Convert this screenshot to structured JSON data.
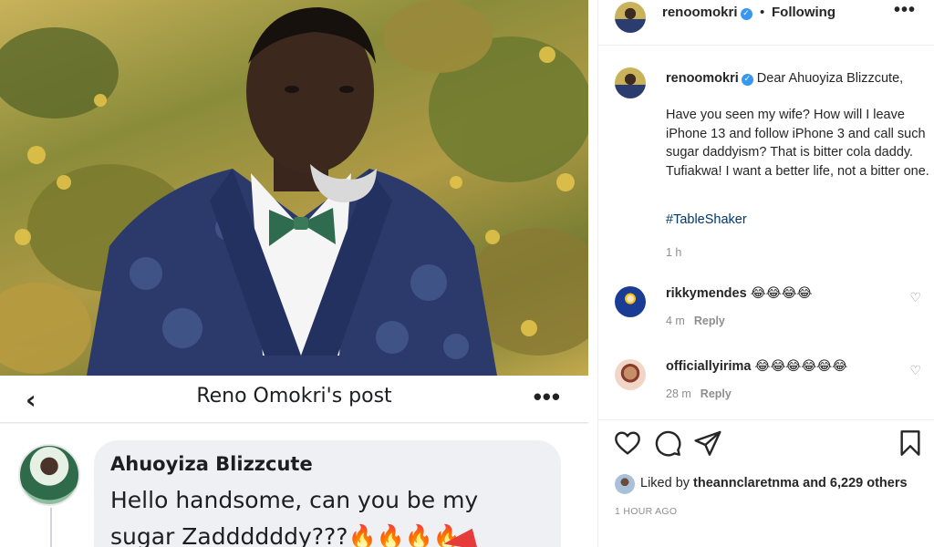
{
  "media": {
    "fb_post_title": "Reno Omokri's post",
    "fb_back": "‹",
    "fb_more": "•••",
    "fb_commenter": "Ahuoyiza Blizzcute",
    "fb_comment": "Hello handsome, can you be my sugar Zaddddddy???🔥🔥🔥🔥"
  },
  "header": {
    "username": "renoomokri",
    "verified": "✓",
    "separator": "•",
    "follow_status": "Following",
    "more": "•••"
  },
  "caption": {
    "username": "renoomokri",
    "verified": "✓",
    "first_line": "Dear Ahuoyiza Blizzcute,",
    "body": "Have you seen my wife? How will I leave iPhone 13 and follow iPhone 3 and call such sugar daddyism? That is bitter cola daddy. Tufiakwa! I want a better life, not a bitter one.",
    "hashtag": "#TableShaker",
    "time": "1 h"
  },
  "comments": [
    {
      "username": "rikkymendes",
      "text": "😂😂😂😂",
      "time": "4 m",
      "reply": "Reply",
      "heart": "♡"
    },
    {
      "username": "officiallyirima",
      "text": "😂😂😂😂😂😂",
      "time": "28 m",
      "reply": "Reply",
      "heart": "♡"
    }
  ],
  "likes": {
    "prefix": "Liked by",
    "user": "theannclaretnma",
    "suffix": "and 6,229 others"
  },
  "post_time": "1 HOUR AGO",
  "icons": {
    "like": "heart-icon",
    "comment": "comment-icon",
    "share": "send-icon",
    "save": "bookmark-icon"
  },
  "colors": {
    "verified": "#3897f0",
    "hashtag": "#00376b",
    "muted": "#8e8e8e",
    "fb_bubble": "#eef0f3"
  }
}
